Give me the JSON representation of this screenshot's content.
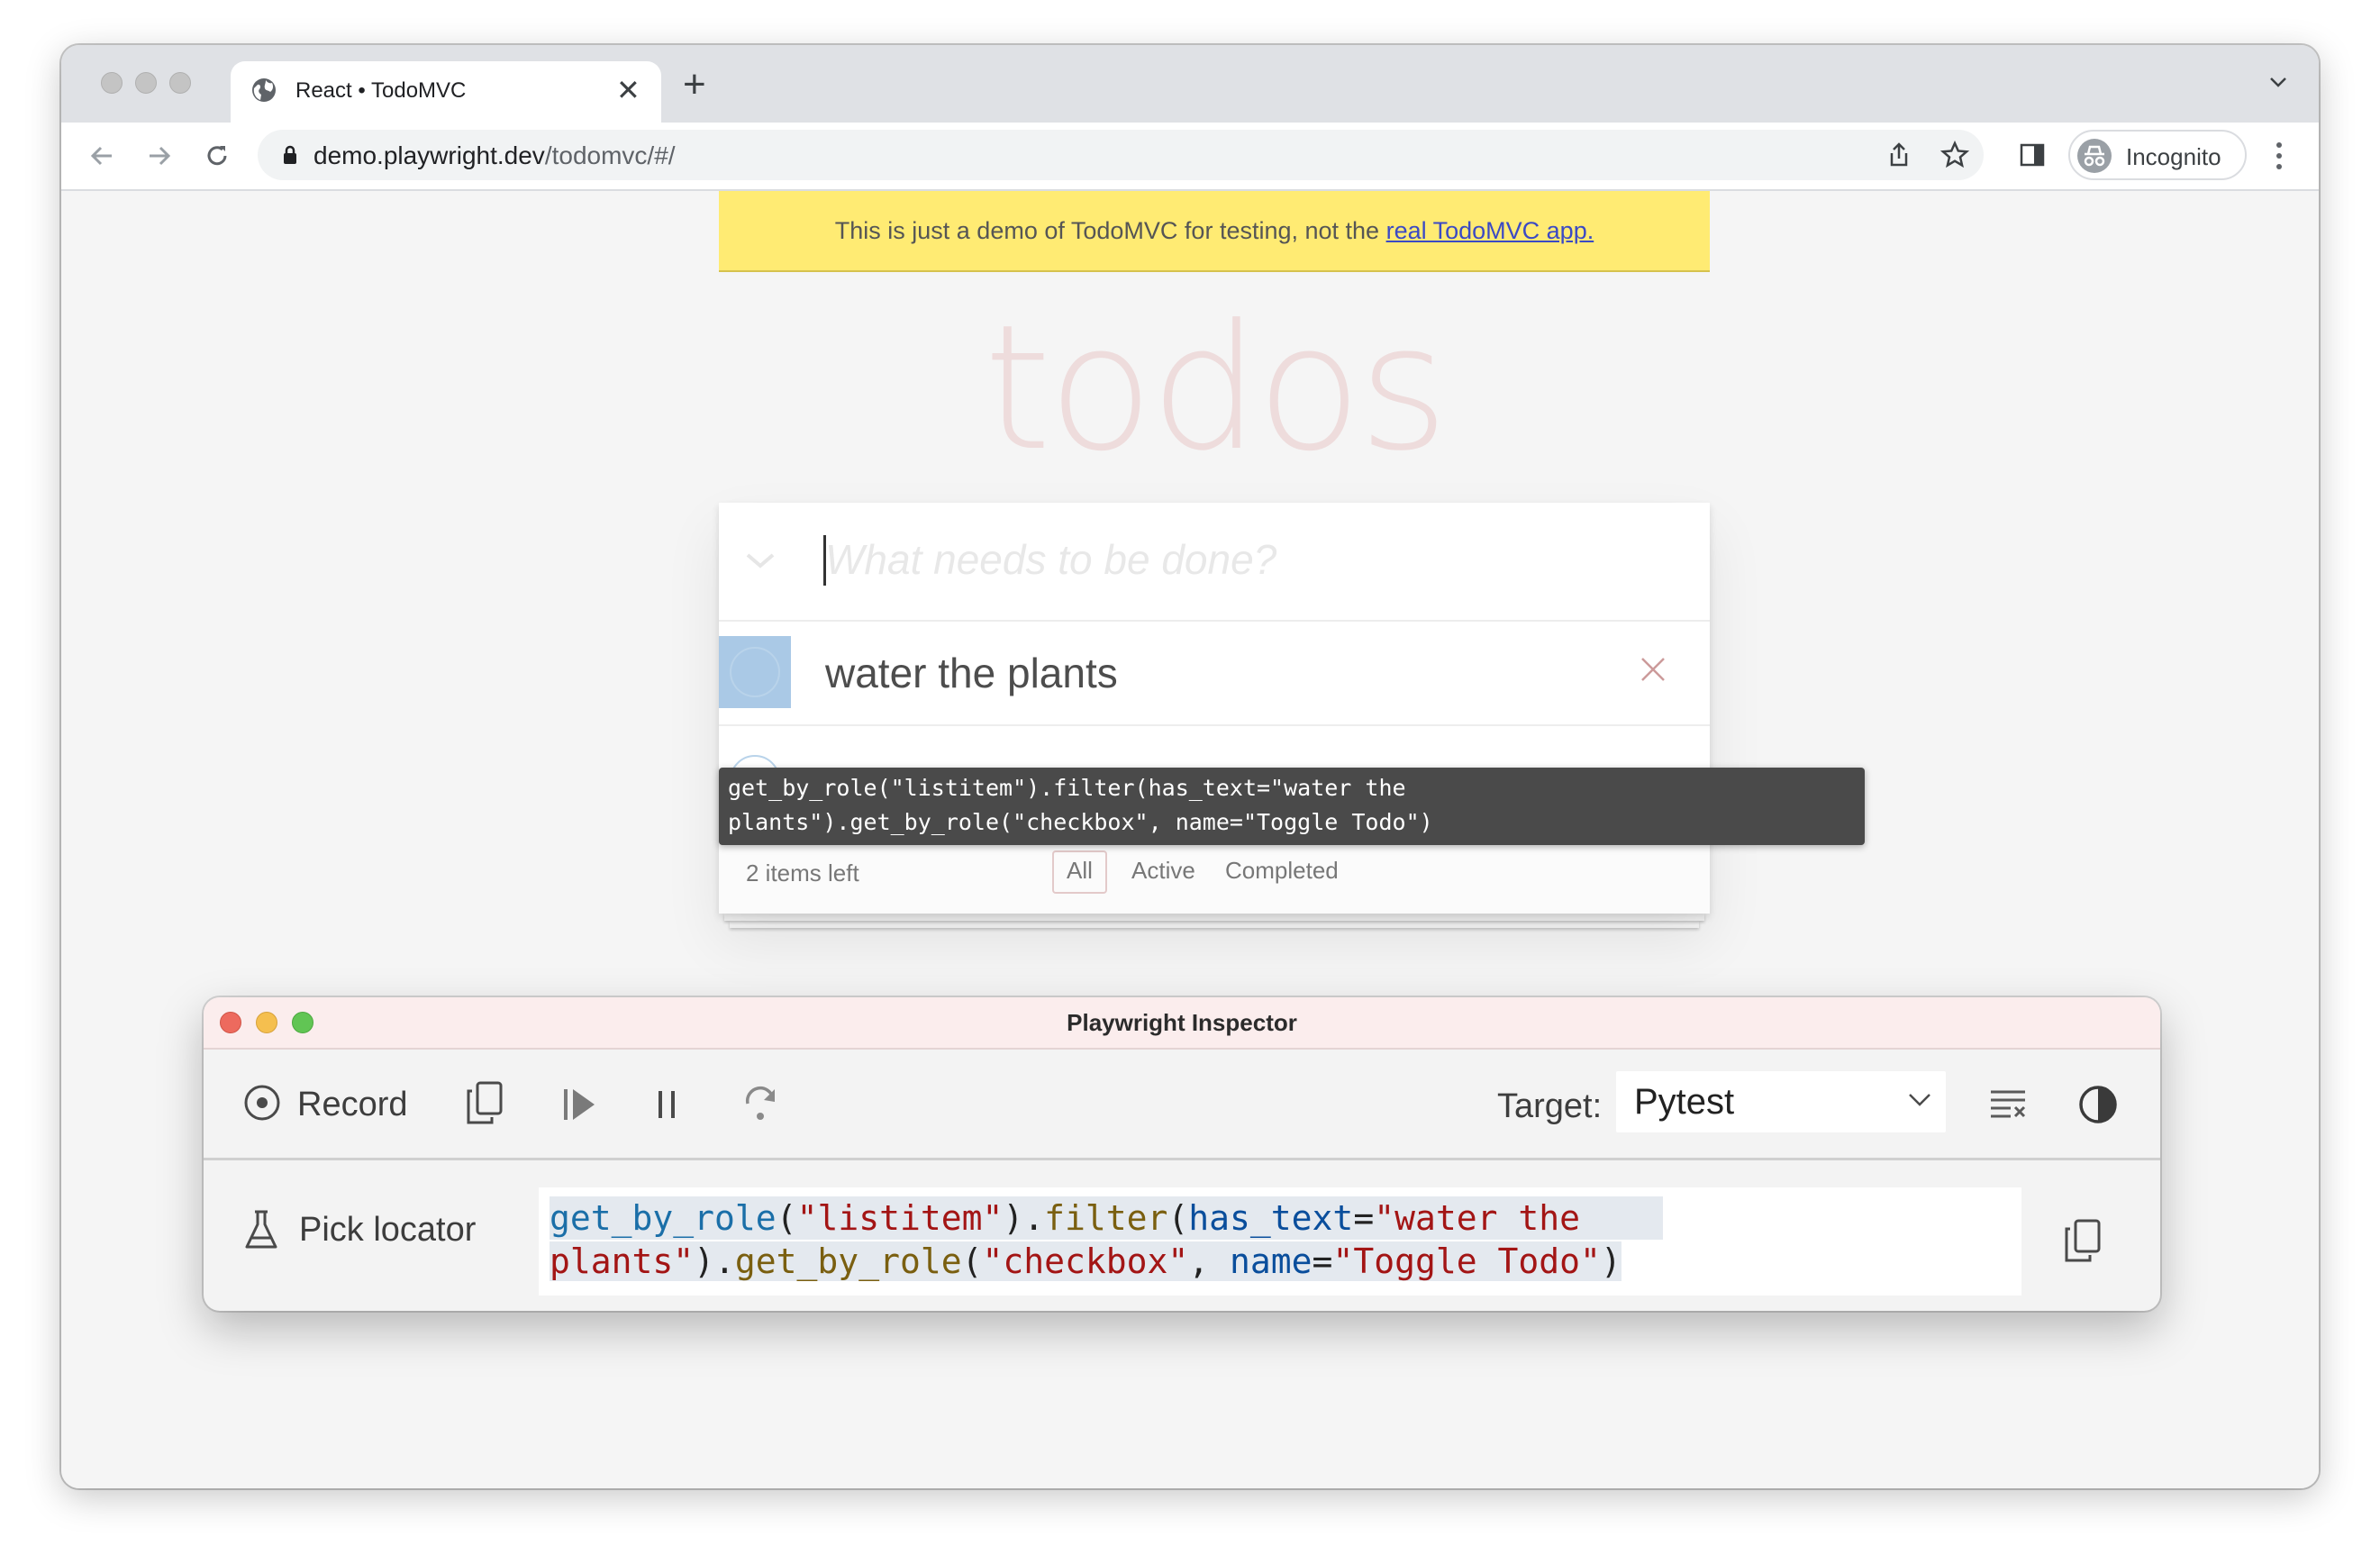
{
  "browser": {
    "tab_title": "React • TodoMVC",
    "url_host": "demo.playwright.dev",
    "url_path": "/todomvc/#/",
    "profile_label": "Incognito"
  },
  "page": {
    "banner_text": "This is just a demo of TodoMVC for testing, not the ",
    "banner_link": "real TodoMVC app.",
    "app_title": "todos",
    "new_todo_placeholder": "What needs to be done?",
    "todos": [
      {
        "label": "water the plants"
      }
    ],
    "items_left": "2 items left",
    "filters": [
      "All",
      "Active",
      "Completed"
    ],
    "selected_filter": "All"
  },
  "tooltip": {
    "line1": "get_by_role(\"listitem\").filter(has_text=\"water the",
    "line2": "plants\").get_by_role(\"checkbox\", name=\"Toggle Todo\")"
  },
  "inspector": {
    "title": "Playwright Inspector",
    "record_label": "Record",
    "target_label": "Target:",
    "target_value": "Pytest",
    "pick_locator_label": "Pick locator",
    "locator": {
      "l1_fn1": "get_by_role",
      "l1_p1": "(",
      "l1_s1": "\"listitem\"",
      "l1_p2": ").",
      "l1_fn2": "filter",
      "l1_p3": "(",
      "l1_kw1": "has_text",
      "l1_eq": "=",
      "l1_s2": "\"water the",
      "l2_s2": "plants\"",
      "l2_p1": ").",
      "l2_fn": "get_by_role",
      "l2_p2": "(",
      "l2_s3": "\"checkbox\"",
      "l2_comma": ", ",
      "l2_kw": "name",
      "l2_eq": "=",
      "l2_s4": "\"Toggle Todo\"",
      "l2_end": ")"
    }
  },
  "colors": {
    "banner_bg": "#ffeb73",
    "inspector_titlebar": "#fbeded",
    "close_dot": "#ed6a5e",
    "minimize_dot": "#f5bf4f",
    "zoom_dot": "#61c554"
  }
}
